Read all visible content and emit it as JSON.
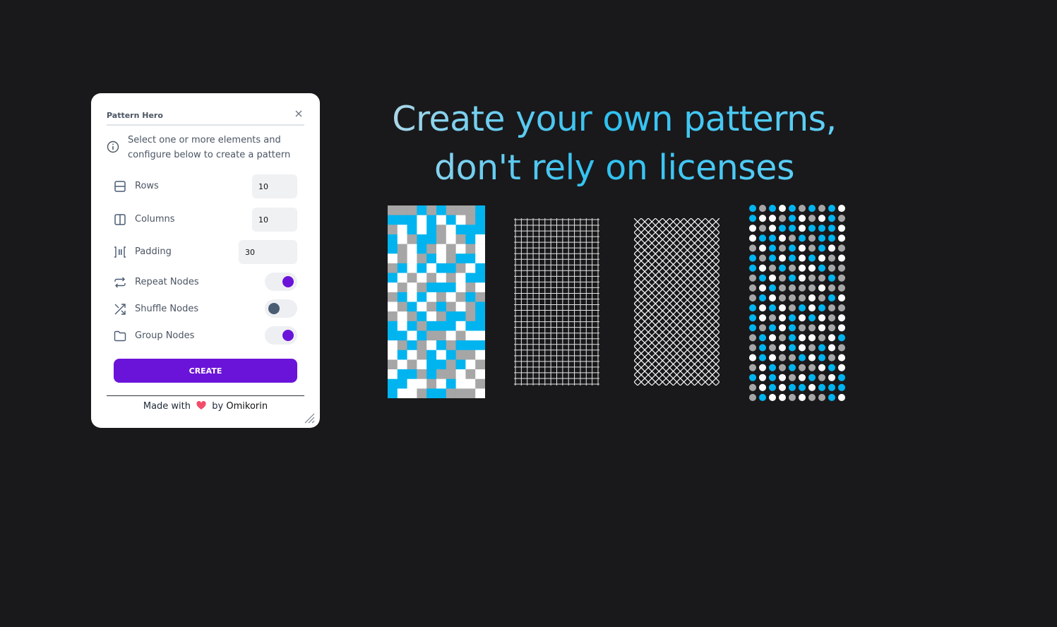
{
  "panel": {
    "title": "Pattern Hero",
    "info_text": "Select one or more elements and configure below to create a pattern",
    "rows": {
      "label": "Rows",
      "value": "10",
      "icon": "rows-icon"
    },
    "columns": {
      "label": "Columns",
      "value": "10",
      "icon": "columns-icon"
    },
    "padding": {
      "label": "Padding",
      "value": "30",
      "icon": "padding-icon"
    },
    "repeat_nodes": {
      "label": "Repeat Nodes",
      "on": true,
      "icon": "repeat-icon"
    },
    "shuffle_nodes": {
      "label": "Shuffle Nodes",
      "on": false,
      "icon": "shuffle-icon"
    },
    "group_nodes": {
      "label": "Group Nodes",
      "on": true,
      "icon": "folder-icon"
    },
    "create_label": "CREATE",
    "footer": {
      "made_with": "Made with",
      "by": "by",
      "author": "Omikorin"
    },
    "accent": "#6b14d9"
  },
  "hero": {
    "line1": "Create your own patterns,",
    "line2": "don't rely on licenses"
  },
  "colors": {
    "background": "#19191b",
    "cyan": "#00b4f0",
    "grey": "#a6a6a6",
    "white": "#ffffff"
  },
  "patterns": {
    "squares": {
      "columns": 10,
      "rows": 20,
      "grid": [
        "GGGCGCGGGC",
        "CCCWCWCWGC",
        "GWCWCGWCCC",
        "CWGCCGWGCW",
        "CGWCGWGWGW",
        "WGWGCWGCCW",
        "GCWCWCCGWC",
        "CWGWGWGWCC",
        "WGWGCCCWGW",
        "GCWCWGWGCG",
        "WGCWGCGWGC",
        "GWGCWGCCGC",
        "CWCGCCCWCC",
        "CCWCGGWGWW",
        "WGCGWCGCCC",
        "WCWGCWCGGW",
        "GWGWCCGCWG",
        "WCCGCGGWGW",
        "CCWWGWCWWG",
        "CWWGCCGGGW"
      ]
    },
    "grid_lines": {
      "columns": 15,
      "rows": 30
    },
    "diamonds": {
      "cells": 12,
      "rows": 24
    },
    "dots": {
      "columns": 10,
      "rows": 20,
      "grid": [
        "CGCWCGCGCW",
        "CWWGCWGWCG",
        "WGWCCWCCCW",
        "WCCWGCGCCW",
        "GWCGCWGCWG",
        "CGCWCWCWGW",
        "CWGCGWWCGG",
        "GCWGCWGGCG",
        "GWCGGGGWGG",
        "GCWGGGWGCW",
        "CWCWGCWCGG",
        "CWGWCWCWGW",
        "CGCWCGGWGW",
        "GCWGCWWGWC",
        "GCGWCWGCWG",
        "WCWGGCWCGW",
        "GWCGCGGWCW",
        "CWCWGWCGWC",
        "GWCWCCWCCC",
        "GCWWGWGGCW"
      ]
    }
  }
}
